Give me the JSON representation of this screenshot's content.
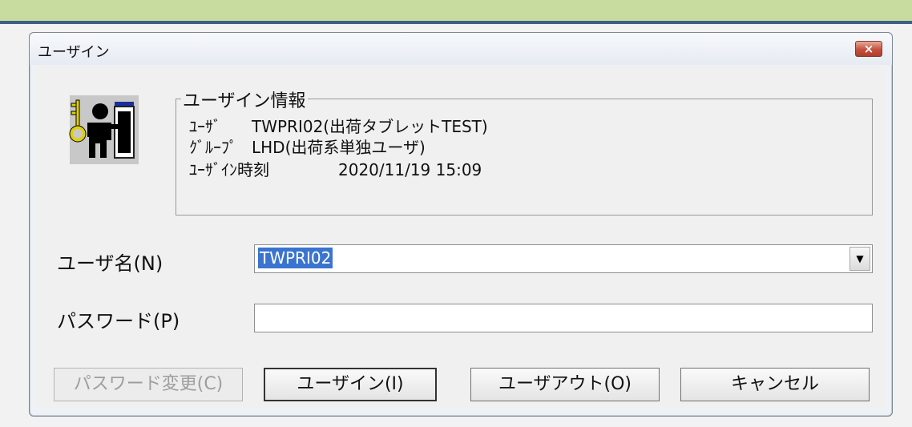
{
  "window": {
    "title": "ユーザイン",
    "close_label": "×"
  },
  "login_info": {
    "heading": "ユーザイン情報",
    "user_label": "ﾕｰｻﾞ",
    "user_value": "TWPRI02(出荷タブレットTEST)",
    "group_label": "ｸﾞﾙｰﾌﾟ",
    "group_value": "LHD(出荷系単独ユーザ)",
    "time_label": "ﾕｰｻﾞｲﾝ時刻",
    "time_value": "2020/11/19 15:09"
  },
  "form": {
    "username_label": "ユーザ名(N)",
    "username_value": "TWPRI02",
    "password_label": "パスワード(P)",
    "password_value": ""
  },
  "buttons": {
    "change_password": "パスワード変更(C)",
    "user_in": "ユーザイン(I)",
    "user_out": "ユーザアウト(O)",
    "cancel": "キャンセル"
  },
  "icons": {
    "app_icon": "user-key-door-icon",
    "close_icon": "close-icon",
    "dropdown_icon": "chevron-down-icon"
  }
}
